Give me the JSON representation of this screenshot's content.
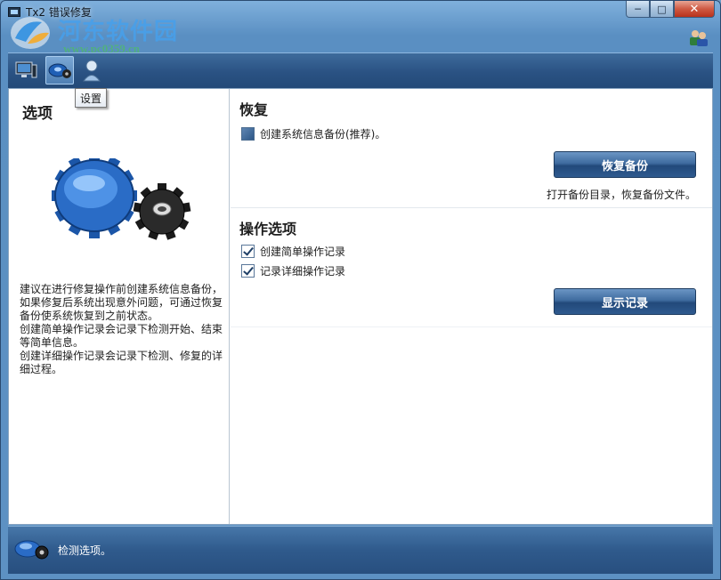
{
  "window": {
    "title": "Tx2 错误修复",
    "minimize_icon": "minimize-icon",
    "maximize_icon": "maximize-icon",
    "close_icon": "close-icon"
  },
  "watermark": {
    "title": "河东软件园",
    "url": "www.pc0359.cn"
  },
  "toolbar": {
    "items": [
      {
        "icon": "monitor-icon",
        "name": "检测"
      },
      {
        "icon": "gear-icon",
        "name": "设置"
      },
      {
        "icon": "user-icon",
        "name": "用户"
      }
    ],
    "tooltip": "设置"
  },
  "left": {
    "title": "选项",
    "description": "建议在进行修复操作前创建系统信息备份，如果修复后系统出现意外问题，可通过恢复备份使系统恢复到之前状态。\n创建简单操作记录会记录下检测开始、结束等简单信息。\n创建详细操作记录会记录下检测、修复的详细过程。"
  },
  "restore": {
    "title": "恢复",
    "checkbox_label": "创建系统信息备份(推荐)。",
    "checked": true,
    "button_label": "恢复备份",
    "hint": "打开备份目录，恢复备份文件。"
  },
  "options": {
    "title": "操作选项",
    "simple_log_label": "创建简单操作记录",
    "simple_log_checked": true,
    "detail_log_label": "记录详细操作记录",
    "detail_log_checked": true,
    "button_label": "显示记录"
  },
  "status": {
    "text": "检测选项。"
  },
  "colors": {
    "titlebar": "#5d91c3",
    "toolbar": "#2a5283",
    "button": "#3e6b9f",
    "statusbar": "#2f5a8c"
  }
}
